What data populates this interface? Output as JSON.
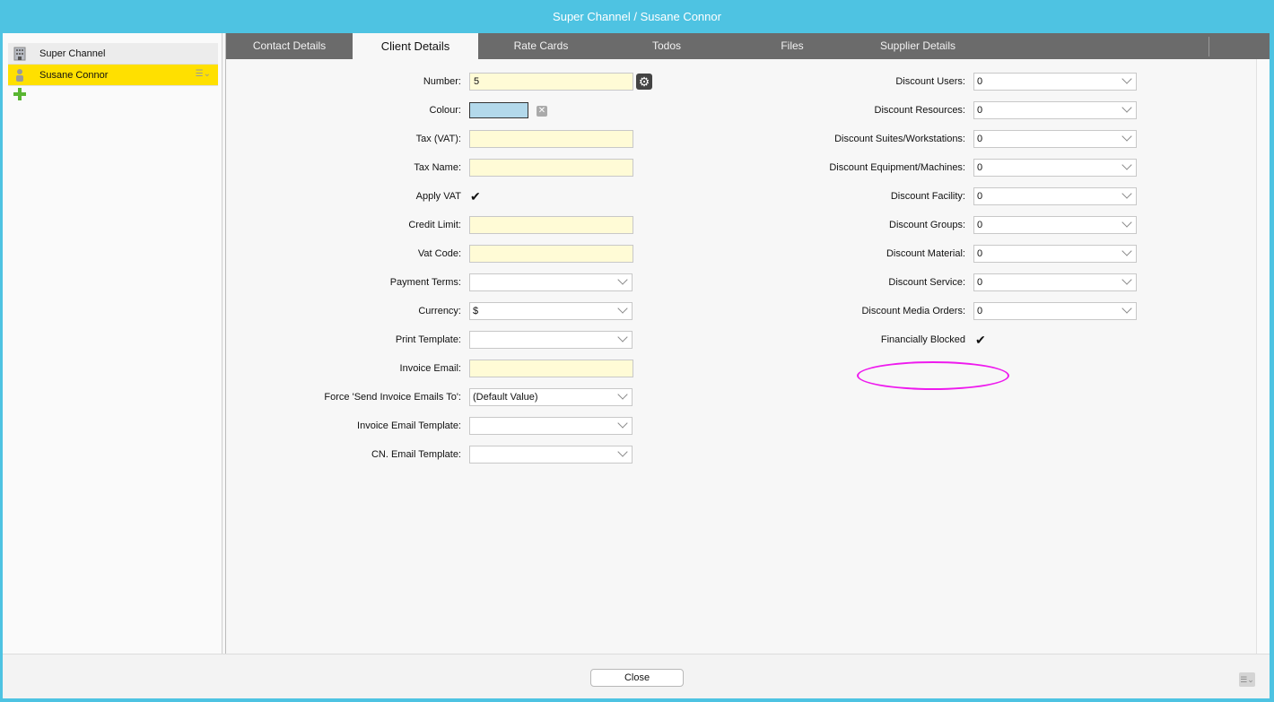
{
  "window": {
    "title": "Super Channel / Susane Connor"
  },
  "sidebar": {
    "items": [
      {
        "label": "Super Channel",
        "icon": "building-icon"
      },
      {
        "label": "Susane Connor",
        "icon": "person-icon",
        "selected": true
      }
    ]
  },
  "tabs": [
    {
      "label": "Contact Details"
    },
    {
      "label": "Client Details",
      "active": true
    },
    {
      "label": "Rate Cards"
    },
    {
      "label": "Todos"
    },
    {
      "label": "Files"
    },
    {
      "label": "Supplier Details"
    }
  ],
  "left_form": {
    "number": {
      "label": "Number:",
      "value": "5"
    },
    "colour": {
      "label": "Colour:",
      "value": "#b3d9eb"
    },
    "tax_vat": {
      "label": "Tax (VAT):",
      "value": ""
    },
    "tax_name": {
      "label": "Tax Name:",
      "value": ""
    },
    "apply_vat": {
      "label": "Apply VAT",
      "checked": true
    },
    "credit_limit": {
      "label": "Credit Limit:",
      "value": ""
    },
    "vat_code": {
      "label": "Vat Code:",
      "value": ""
    },
    "payment_terms": {
      "label": "Payment Terms:",
      "value": ""
    },
    "currency": {
      "label": "Currency:",
      "value": "$"
    },
    "print_template": {
      "label": "Print Template:",
      "value": ""
    },
    "invoice_email": {
      "label": "Invoice Email:",
      "value": ""
    },
    "force_send": {
      "label": "Force 'Send Invoice Emails To':",
      "value": "(Default Value)"
    },
    "invoice_email_template": {
      "label": "Invoice Email Template:",
      "value": ""
    },
    "cn_email_template": {
      "label": "CN. Email Template:",
      "value": ""
    }
  },
  "right_form": {
    "discounts": [
      {
        "label": "Discount Users:",
        "value": "0"
      },
      {
        "label": "Discount Resources:",
        "value": "0"
      },
      {
        "label": "Discount Suites/Workstations:",
        "value": "0"
      },
      {
        "label": "Discount Equipment/Machines:",
        "value": "0"
      },
      {
        "label": "Discount Facility:",
        "value": "0"
      },
      {
        "label": "Discount Groups:",
        "value": "0"
      },
      {
        "label": "Discount Material:",
        "value": "0"
      },
      {
        "label": "Discount Service:",
        "value": "0"
      },
      {
        "label": "Discount Media Orders:",
        "value": "0"
      }
    ],
    "financially_blocked": {
      "label": "Financially Blocked",
      "checked": true
    }
  },
  "footer": {
    "close_label": "Close"
  },
  "colors": {
    "title_bar": "#4ec3e2",
    "selected_row": "#ffe000",
    "tab_bar": "#6b6b6b",
    "highlight": "#ee1aee",
    "input_bg": "#fffbd6"
  }
}
